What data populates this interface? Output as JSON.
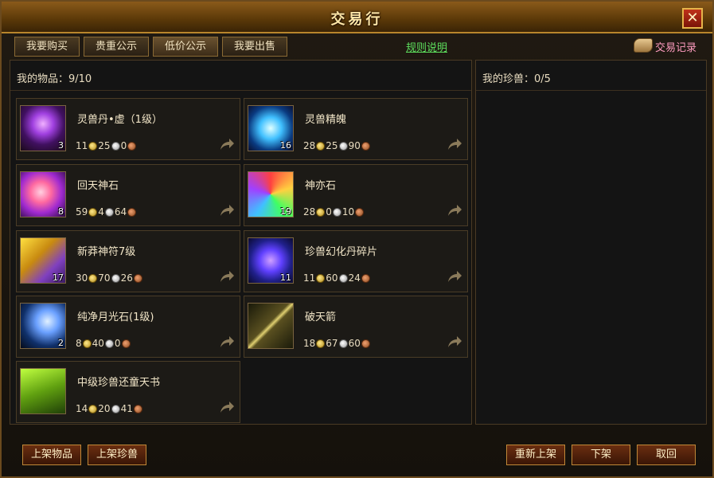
{
  "window": {
    "title": "交易行",
    "close_label": "✕"
  },
  "tabs": [
    {
      "label": "我要购买"
    },
    {
      "label": "贵重公示"
    },
    {
      "label": "低价公示"
    },
    {
      "label": "我要出售"
    }
  ],
  "rules_link": "规则说明",
  "trade_log": "交易记录",
  "items_panel": {
    "header": "我的物品：9/10"
  },
  "pets_panel": {
    "header": "我的珍兽：0/5"
  },
  "items": [
    {
      "name": "灵兽丹•虚（1级）",
      "qty": "3",
      "gold": "11",
      "silver": "25",
      "copper": "0",
      "icon": "purple-orb-icon"
    },
    {
      "name": "灵兽精魄",
      "qty": "16",
      "gold": "28",
      "silver": "25",
      "copper": "90",
      "icon": "blue-spirit-icon"
    },
    {
      "name": "回天神石",
      "qty": "8",
      "gold": "59",
      "silver": "4",
      "copper": "64",
      "icon": "pink-stone-icon"
    },
    {
      "name": "神亦石",
      "qty": "19",
      "gold": "28",
      "silver": "0",
      "copper": "10",
      "icon": "rainbow-stone-icon"
    },
    {
      "name": "新莽神符7级",
      "qty": "17",
      "gold": "30",
      "silver": "70",
      "copper": "26",
      "icon": "rune-icon"
    },
    {
      "name": "珍兽幻化丹碎片",
      "qty": "11",
      "gold": "11",
      "silver": "60",
      "copper": "24",
      "icon": "shard-icon"
    },
    {
      "name": "纯净月光石(1级)",
      "qty": "2",
      "gold": "8",
      "silver": "40",
      "copper": "0",
      "icon": "moonstone-icon"
    },
    {
      "name": "破天箭",
      "qty": "",
      "gold": "18",
      "silver": "67",
      "copper": "60",
      "icon": "arrow-icon"
    },
    {
      "name": "中级珍兽还童天书",
      "qty": "",
      "gold": "14",
      "silver": "20",
      "copper": "41",
      "icon": "book-icon"
    }
  ],
  "buttons": {
    "list_item": "上架物品",
    "list_pet": "上架珍兽",
    "relist": "重新上架",
    "delist": "下架",
    "cancel": "取回"
  }
}
